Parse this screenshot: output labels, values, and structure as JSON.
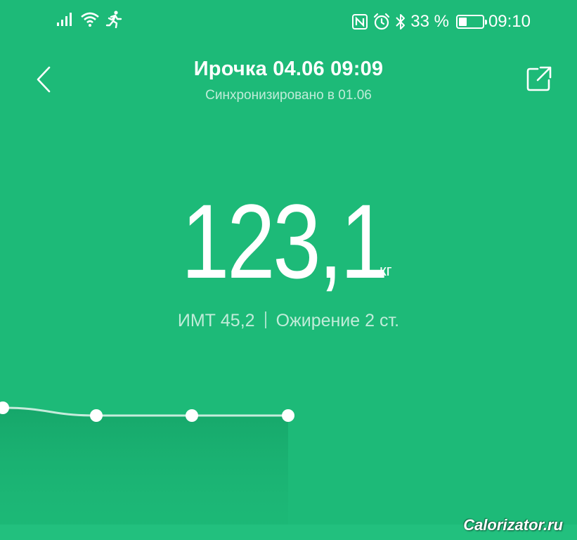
{
  "status_bar": {
    "signal_icon": "signal-bars-icon",
    "wifi_icon": "wifi-icon",
    "run_icon": "running-man-icon",
    "nfc_icon": "nfc-icon",
    "alarm_icon": "alarm-icon",
    "bluetooth_icon": "bluetooth-icon",
    "battery_percent": "33 %",
    "battery_level": 0.33,
    "time": "09:10"
  },
  "header": {
    "title": "Ирочка 04.06 09:09",
    "subtitle": "Синхронизировано в 01.06"
  },
  "measurement": {
    "weight": "123,1",
    "unit": "кг",
    "bmi": "ИМТ 45,2",
    "category": "Ожирение 2 ст."
  },
  "trend_chart": {
    "points": [
      123.2,
      123.1,
      123.1,
      123.1
    ]
  },
  "watermark": "Calorizator.ru",
  "colors": {
    "background": "#1dba78",
    "text": "#ffffff"
  }
}
